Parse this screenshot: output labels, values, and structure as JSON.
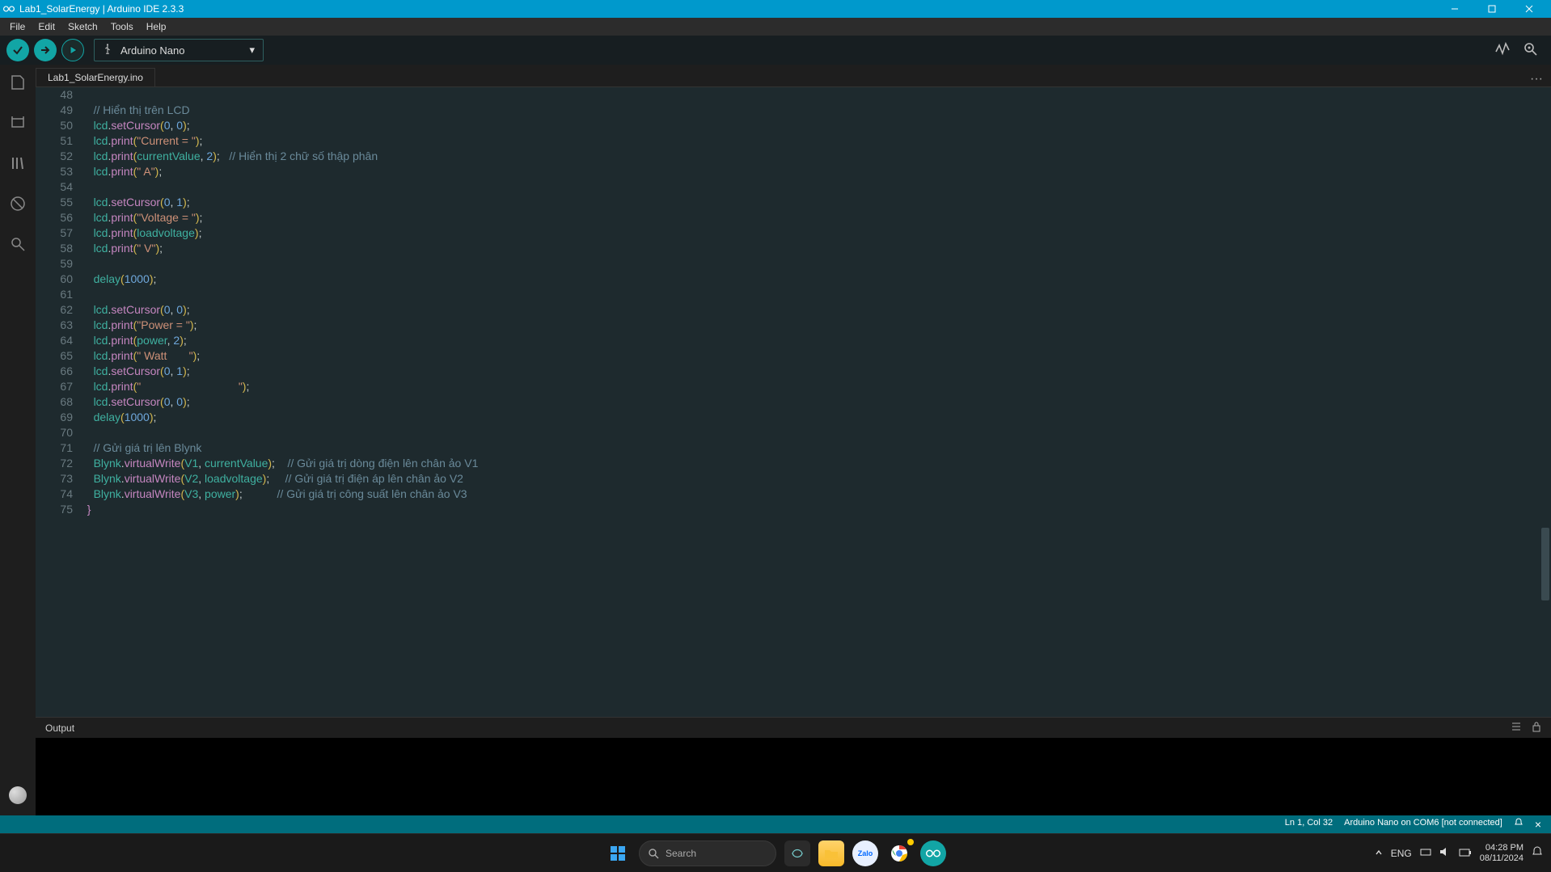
{
  "window": {
    "title": "Lab1_SolarEnergy | Arduino IDE 2.3.3"
  },
  "menu": {
    "file": "File",
    "edit": "Edit",
    "sketch": "Sketch",
    "tools": "Tools",
    "help": "Help"
  },
  "board": {
    "name": "Arduino Nano"
  },
  "tab": {
    "filename": "Lab1_SolarEnergy.ino"
  },
  "gutter": {
    "start": 48,
    "end": 75
  },
  "code": [
    {
      "n": 48,
      "html": ""
    },
    {
      "n": 49,
      "html": "    <span class='tk-cm'>// Hiển thị trên LCD</span>"
    },
    {
      "n": 50,
      "html": "    <span class='tk-id'>lcd</span><span class='tk-pl'>.</span><span class='tk-fn'>setCursor</span><span class='tk-br'>(</span><span class='tk-num'>0</span><span class='tk-pl'>, </span><span class='tk-num'>0</span><span class='tk-br'>)</span><span class='tk-pl'>;</span>"
    },
    {
      "n": 51,
      "html": "    <span class='tk-id'>lcd</span><span class='tk-pl'>.</span><span class='tk-fn'>print</span><span class='tk-br'>(</span><span class='tk-str'>\"Current = \"</span><span class='tk-br'>)</span><span class='tk-pl'>;</span>"
    },
    {
      "n": 52,
      "html": "    <span class='tk-id'>lcd</span><span class='tk-pl'>.</span><span class='tk-fn'>print</span><span class='tk-br'>(</span><span class='tk-id'>currentValue</span><span class='tk-pl'>, </span><span class='tk-num'>2</span><span class='tk-br'>)</span><span class='tk-pl'>;</span>   <span class='tk-cm'>// Hiển thị 2 chữ số thập phân</span>"
    },
    {
      "n": 53,
      "html": "    <span class='tk-id'>lcd</span><span class='tk-pl'>.</span><span class='tk-fn'>print</span><span class='tk-br'>(</span><span class='tk-str'>\" A\"</span><span class='tk-br'>)</span><span class='tk-pl'>;</span>"
    },
    {
      "n": 54,
      "html": ""
    },
    {
      "n": 55,
      "html": "    <span class='tk-id'>lcd</span><span class='tk-pl'>.</span><span class='tk-fn'>setCursor</span><span class='tk-br'>(</span><span class='tk-num'>0</span><span class='tk-pl'>, </span><span class='tk-num'>1</span><span class='tk-br'>)</span><span class='tk-pl'>;</span>"
    },
    {
      "n": 56,
      "html": "    <span class='tk-id'>lcd</span><span class='tk-pl'>.</span><span class='tk-fn'>print</span><span class='tk-br'>(</span><span class='tk-str'>\"Voltage = \"</span><span class='tk-br'>)</span><span class='tk-pl'>;</span>"
    },
    {
      "n": 57,
      "html": "    <span class='tk-id'>lcd</span><span class='tk-pl'>.</span><span class='tk-fn'>print</span><span class='tk-br'>(</span><span class='tk-id'>loadvoltage</span><span class='tk-br'>)</span><span class='tk-pl'>;</span>"
    },
    {
      "n": 58,
      "html": "    <span class='tk-id'>lcd</span><span class='tk-pl'>.</span><span class='tk-fn'>print</span><span class='tk-br'>(</span><span class='tk-str'>\" V\"</span><span class='tk-br'>)</span><span class='tk-pl'>;</span>"
    },
    {
      "n": 59,
      "html": ""
    },
    {
      "n": 60,
      "html": "    <span class='tk-kw'>delay</span><span class='tk-br'>(</span><span class='tk-num'>1000</span><span class='tk-br'>)</span><span class='tk-pl'>;</span>"
    },
    {
      "n": 61,
      "html": ""
    },
    {
      "n": 62,
      "html": "    <span class='tk-id'>lcd</span><span class='tk-pl'>.</span><span class='tk-fn'>setCursor</span><span class='tk-br'>(</span><span class='tk-num'>0</span><span class='tk-pl'>, </span><span class='tk-num'>0</span><span class='tk-br'>)</span><span class='tk-pl'>;</span>"
    },
    {
      "n": 63,
      "html": "    <span class='tk-id'>lcd</span><span class='tk-pl'>.</span><span class='tk-fn'>print</span><span class='tk-br'>(</span><span class='tk-str'>\"Power = \"</span><span class='tk-br'>)</span><span class='tk-pl'>;</span>"
    },
    {
      "n": 64,
      "html": "    <span class='tk-id'>lcd</span><span class='tk-pl'>.</span><span class='tk-fn'>print</span><span class='tk-br'>(</span><span class='tk-id'>power</span><span class='tk-pl'>, </span><span class='tk-num'>2</span><span class='tk-br'>)</span><span class='tk-pl'>;</span>"
    },
    {
      "n": 65,
      "html": "    <span class='tk-id'>lcd</span><span class='tk-pl'>.</span><span class='tk-fn'>print</span><span class='tk-br'>(</span><span class='tk-str'>\" Watt       \"</span><span class='tk-br'>)</span><span class='tk-pl'>;</span>"
    },
    {
      "n": 66,
      "html": "    <span class='tk-id'>lcd</span><span class='tk-pl'>.</span><span class='tk-fn'>setCursor</span><span class='tk-br'>(</span><span class='tk-num'>0</span><span class='tk-pl'>, </span><span class='tk-num'>1</span><span class='tk-br'>)</span><span class='tk-pl'>;</span>"
    },
    {
      "n": 67,
      "html": "    <span class='tk-id'>lcd</span><span class='tk-pl'>.</span><span class='tk-fn'>print</span><span class='tk-br'>(</span><span class='tk-str'>\"                               \"</span><span class='tk-br'>)</span><span class='tk-pl'>;</span>"
    },
    {
      "n": 68,
      "html": "    <span class='tk-id'>lcd</span><span class='tk-pl'>.</span><span class='tk-fn'>setCursor</span><span class='tk-br'>(</span><span class='tk-num'>0</span><span class='tk-pl'>, </span><span class='tk-num'>0</span><span class='tk-br'>)</span><span class='tk-pl'>;</span>"
    },
    {
      "n": 69,
      "html": "    <span class='tk-kw'>delay</span><span class='tk-br'>(</span><span class='tk-num'>1000</span><span class='tk-br'>)</span><span class='tk-pl'>;</span>"
    },
    {
      "n": 70,
      "html": ""
    },
    {
      "n": 71,
      "html": "    <span class='tk-cm'>// Gửi giá trị lên Blynk</span>"
    },
    {
      "n": 72,
      "html": "    <span class='tk-id'>Blynk</span><span class='tk-pl'>.</span><span class='tk-fn'>virtualWrite</span><span class='tk-br'>(</span><span class='tk-id'>V1</span><span class='tk-pl'>, </span><span class='tk-id'>currentValue</span><span class='tk-br'>)</span><span class='tk-pl'>;</span>    <span class='tk-cm'>// Gửi giá trị dòng điện lên chân ảo V1</span>"
    },
    {
      "n": 73,
      "html": "    <span class='tk-id'>Blynk</span><span class='tk-pl'>.</span><span class='tk-fn'>virtualWrite</span><span class='tk-br'>(</span><span class='tk-id'>V2</span><span class='tk-pl'>, </span><span class='tk-id'>loadvoltage</span><span class='tk-br'>)</span><span class='tk-pl'>;</span>     <span class='tk-cm'>// Gửi giá trị điện áp lên chân ảo V2</span>"
    },
    {
      "n": 74,
      "html": "    <span class='tk-id'>Blynk</span><span class='tk-pl'>.</span><span class='tk-fn'>virtualWrite</span><span class='tk-br'>(</span><span class='tk-id'>V3</span><span class='tk-pl'>, </span><span class='tk-id'>power</span><span class='tk-br'>)</span><span class='tk-pl'>;</span>           <span class='tk-cm'>// Gửi giá trị công suất lên chân ảo V3</span>"
    },
    {
      "n": 75,
      "html": "  <span class='tk-br2'>}</span>"
    }
  ],
  "output": {
    "label": "Output"
  },
  "status": {
    "cursor": "Ln 1, Col 32",
    "board": "Arduino Nano on COM6 [not connected]"
  },
  "taskbar": {
    "search_placeholder": "Search",
    "lang": "ENG",
    "time": "04:28 PM",
    "date": "08/11/2024",
    "zalo": "Zalo"
  }
}
